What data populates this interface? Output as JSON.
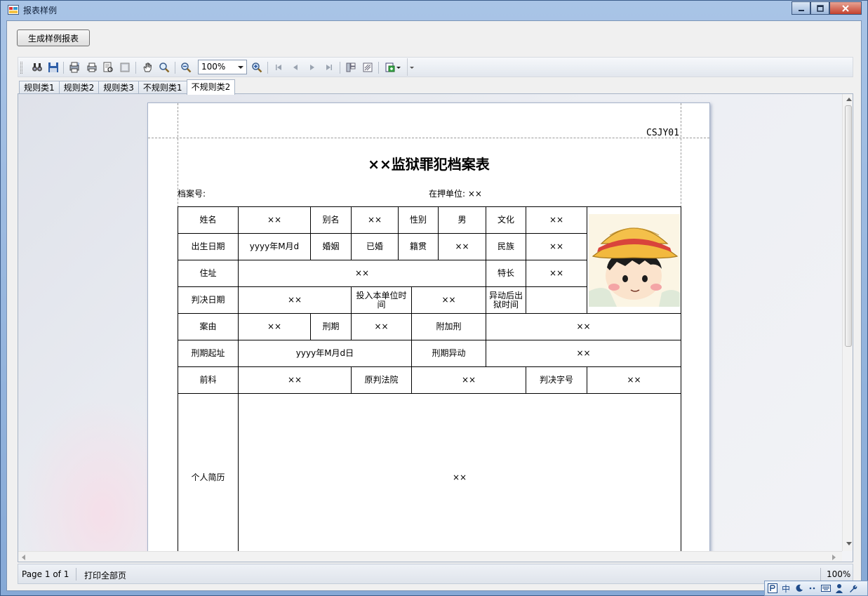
{
  "window": {
    "title": "报表样例",
    "colors": {
      "frame": "#86a9d6",
      "close": "#c4412e",
      "client": "#f0f0f0"
    }
  },
  "generate_button": "生成样例报表",
  "toolbar": {
    "icons": [
      "find-icon",
      "save-icon",
      "page-setup-icon",
      "print-icon",
      "print-preview-icon",
      "export-icon",
      "hand-icon",
      "magnifier-icon",
      "zoom-out-icon",
      "zoom-in-icon",
      "first-page-icon",
      "prev-page-icon",
      "next-page-icon",
      "last-page-icon",
      "group-tree-icon",
      "parameters-icon",
      "export-dropdown-icon"
    ],
    "zoom_value": "100%"
  },
  "tabs": [
    {
      "label": "规则类1",
      "active": false
    },
    {
      "label": "规则类2",
      "active": false
    },
    {
      "label": "规则类3",
      "active": false
    },
    {
      "label": "不规则类1",
      "active": false
    },
    {
      "label": "不规则类2",
      "active": true
    }
  ],
  "report": {
    "code": "CSJY01",
    "title": "××监狱罪犯档案表",
    "archive_no_label": "档案号:",
    "unit_label": "在押单位: ××",
    "rows": {
      "r1": [
        "姓名",
        "××",
        "别名",
        "××",
        "性别",
        "男",
        "文化",
        "××"
      ],
      "r2": [
        "出生日期",
        "yyyy年M月d",
        "婚姻",
        "已婚",
        "籍贯",
        "××",
        "民族",
        "××"
      ],
      "r3": [
        "住址",
        "××",
        "特长",
        "××"
      ],
      "r4": [
        "判决日期",
        "××",
        "投入本单位时间",
        "××",
        "异动后出狱时间",
        ""
      ],
      "r5": [
        "案由",
        "××",
        "刑期",
        "××",
        "附加刑",
        "××"
      ],
      "r6": [
        "刑期起址",
        "yyyy年M月d日",
        "刑期异动",
        "××"
      ],
      "r7": [
        "前科",
        "××",
        "原判法院",
        "××",
        "判决字号",
        "××"
      ],
      "r8": [
        "个人简历",
        "××"
      ]
    },
    "photo_icon": "cartoon-girl-photo"
  },
  "statusbar": {
    "page": "Page 1 of 1",
    "print_all": "打印全部页",
    "zoom": "100%"
  },
  "ime": {
    "mode": "中",
    "icons": [
      "ime-logo-icon",
      "moon-icon",
      "punctuation-icon",
      "keyboard-icon",
      "user-icon",
      "wrench-icon"
    ]
  }
}
